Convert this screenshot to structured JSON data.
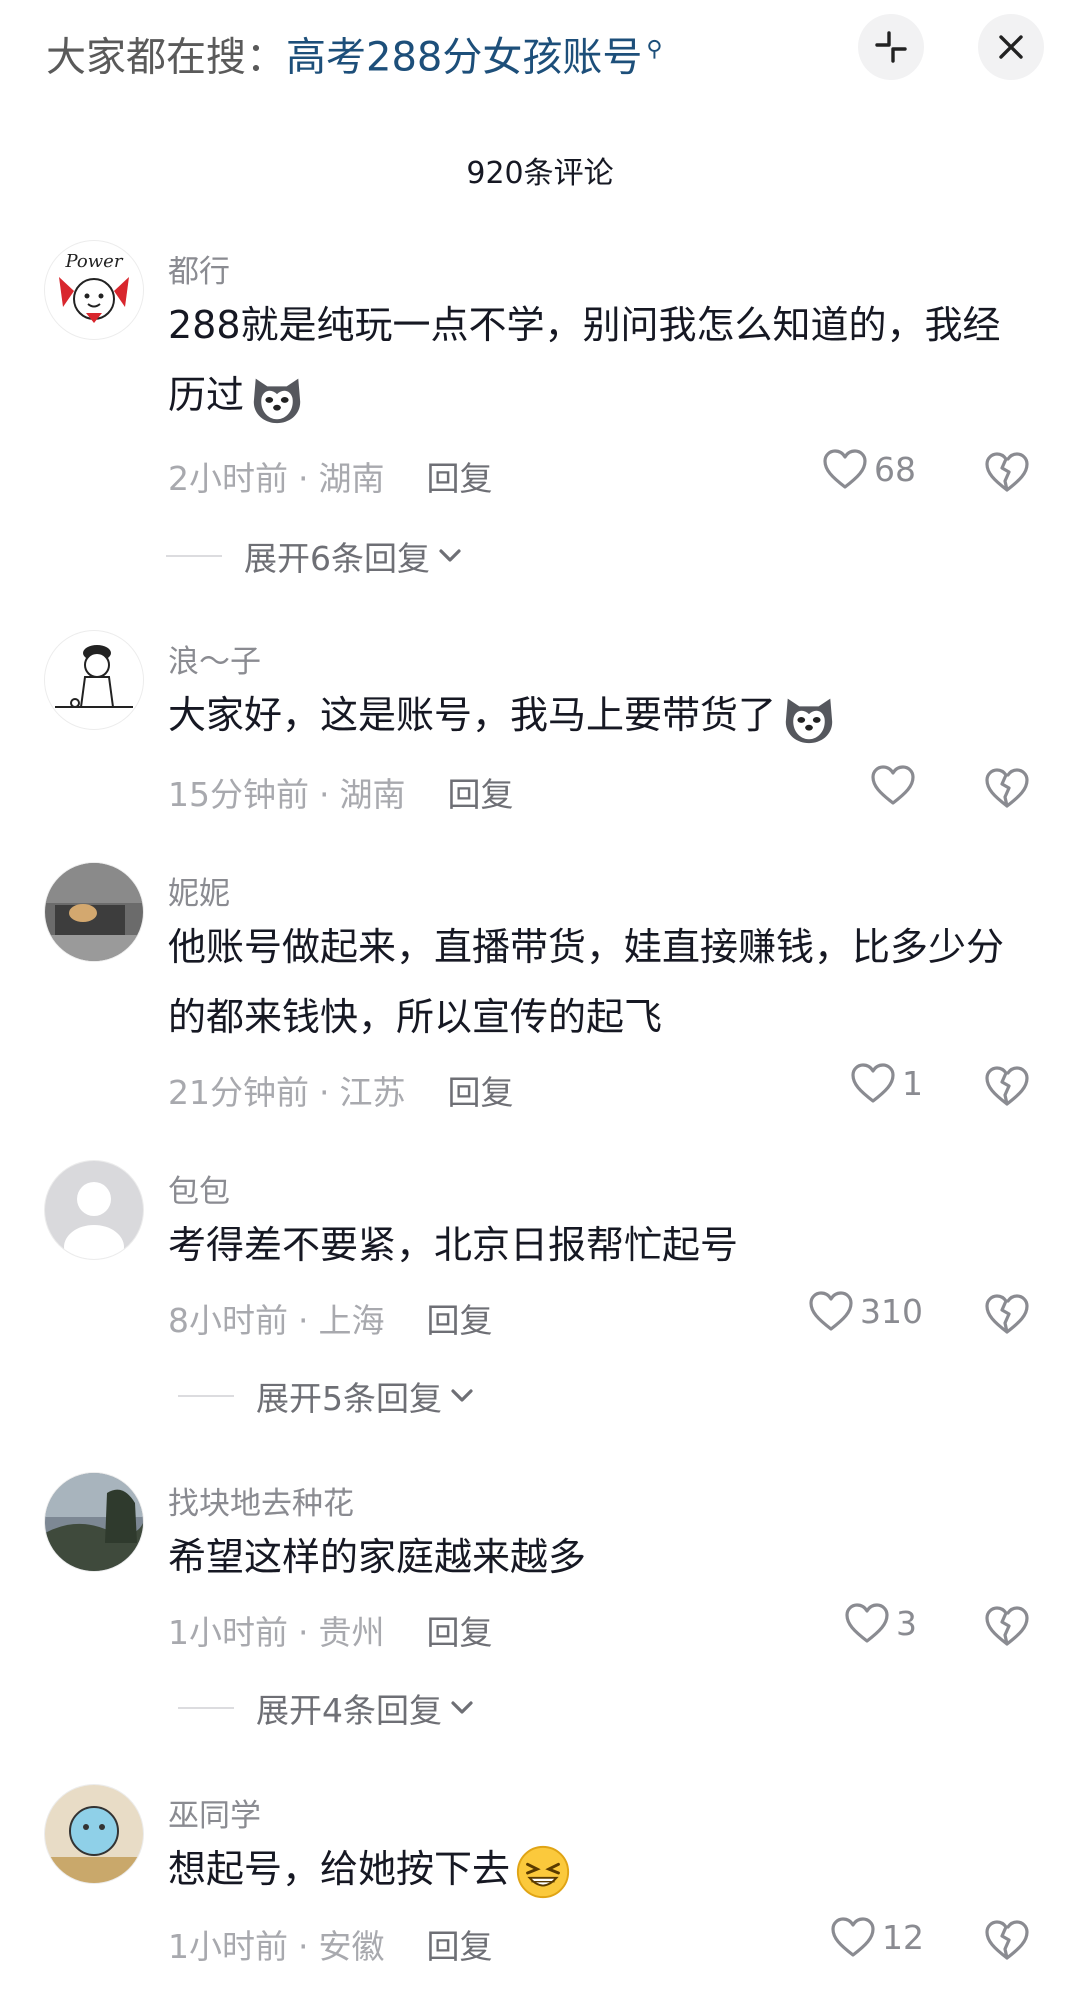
{
  "search_bar": {
    "prefix": "大家都在搜：",
    "term": "高考288分女孩账号"
  },
  "comment_count_title": "920条评论",
  "comments": [
    {
      "user": "都行",
      "text": "288就是纯玩一点不学，别问我怎么知道的，我经历过",
      "time": "2小时前",
      "location": "湖南",
      "reply": "回复",
      "likes": "68",
      "expand": "展开6条回复"
    },
    {
      "user": "浪～子",
      "text": "大家好，这是账号，我马上要带货了",
      "time": "15分钟前",
      "location": "湖南",
      "reply": "回复",
      "likes": ""
    },
    {
      "user": "妮妮",
      "text": "他账号做起来，直播带货，娃直接赚钱，比多少分的都来钱快，所以宣传的起飞",
      "time": "21分钟前",
      "location": "江苏",
      "reply": "回复",
      "likes": "1"
    },
    {
      "user": "包包",
      "text": "考得差不要紧，北京日报帮忙起号",
      "time": "8小时前",
      "location": "上海",
      "reply": "回复",
      "likes": "310",
      "expand": "展开5条回复"
    },
    {
      "user": "找块地去种花",
      "text": "希望这样的家庭越来越多",
      "time": "1小时前",
      "location": "贵州",
      "reply": "回复",
      "likes": "3",
      "expand": "展开4条回复"
    },
    {
      "user": "巫同学",
      "text": "想起号，给她按下去",
      "time": "1小时前",
      "location": "安徽",
      "reply": "回复",
      "likes": "12"
    }
  ],
  "avatar_1_text": "Power"
}
